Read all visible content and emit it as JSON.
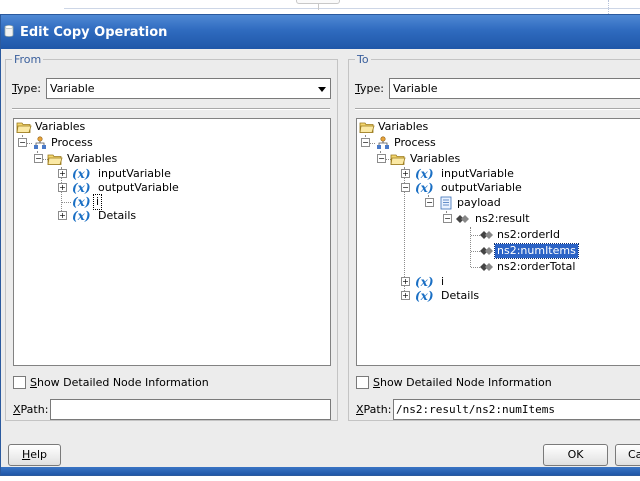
{
  "window": {
    "title": "Edit Copy Operation"
  },
  "from": {
    "group_title": "From",
    "type_label_prefix": "T",
    "type_label_rest": "ype:",
    "type_value": "Variable",
    "tree": {
      "root": "Variables",
      "process": "Process",
      "variables": "Variables",
      "inputVariable": "inputVariable",
      "outputVariable": "outputVariable",
      "i": "i",
      "details": "Details"
    },
    "show_detail_prefix": "S",
    "show_detail_rest": "how Detailed Node Information",
    "xpath_label_prefix": "X",
    "xpath_label_rest": "Path:",
    "xpath_value": ""
  },
  "to": {
    "group_title": "To",
    "type_label_prefix": "T",
    "type_label_rest": "ype:",
    "type_value": "Variable",
    "tree": {
      "root": "Variables",
      "process": "Process",
      "variables": "Variables",
      "inputVariable": "inputVariable",
      "outputVariable": "outputVariable",
      "payload": "payload",
      "result": "ns2:result",
      "orderId": "ns2:orderId",
      "numItems": "ns2:numItems",
      "orderTotal": "ns2:orderTotal",
      "i": "i",
      "details": "Details"
    },
    "show_detail_prefix": "S",
    "show_detail_rest": "how Detailed Node Information",
    "xpath_label_prefix": "X",
    "xpath_label_rest": "Path:",
    "xpath_value": "/ns2:result/ns2:numItems"
  },
  "buttons": {
    "help_prefix": "H",
    "help_rest": "elp",
    "ok": "OK",
    "cancel": "Ca"
  },
  "colors": {
    "title_bar": "#2f6bbf",
    "selection": "#2b63c6",
    "variable_icon": "#1a6fc4"
  }
}
